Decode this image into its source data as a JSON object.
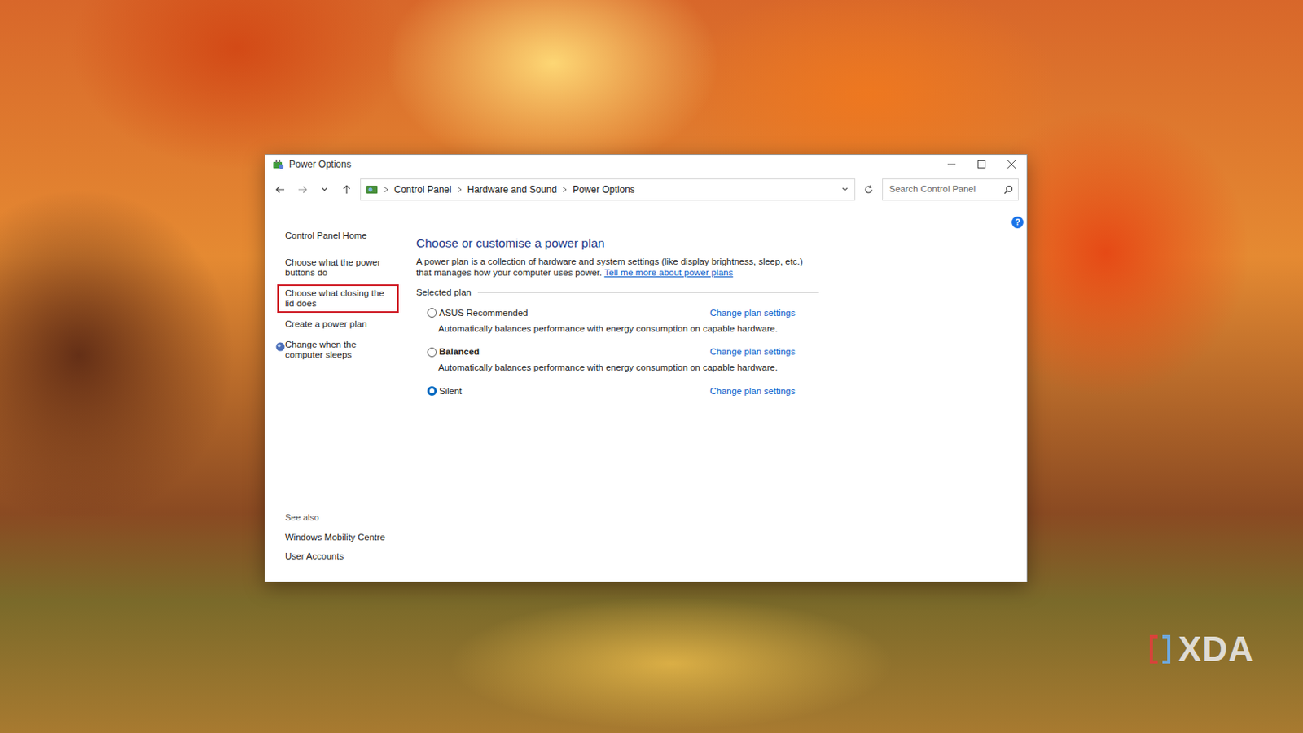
{
  "window": {
    "title": "Power Options"
  },
  "breadcrumb": [
    "Control Panel",
    "Hardware and Sound",
    "Power Options"
  ],
  "search": {
    "placeholder": "Search Control Panel"
  },
  "sidebar": {
    "items": [
      {
        "label": "Control Panel Home",
        "highlighted": false,
        "kind": "plain"
      },
      {
        "label": "Choose what the power buttons do",
        "highlighted": false,
        "kind": "plain"
      },
      {
        "label": "Choose what closing the lid does",
        "highlighted": true,
        "kind": "plain"
      },
      {
        "label": "Create a power plan",
        "highlighted": false,
        "kind": "plain"
      },
      {
        "label": "Change when the computer sleeps",
        "highlighted": false,
        "kind": "icon"
      }
    ],
    "see_also": {
      "title": "See also",
      "items": [
        "Windows Mobility Centre",
        "User Accounts"
      ]
    }
  },
  "main": {
    "heading": "Choose or customise a power plan",
    "description": "A power plan is a collection of hardware and system settings (like display brightness, sleep, etc.) that manages how your computer uses power.",
    "link": "Tell me more about power plans",
    "section": "Selected plan",
    "plans": [
      {
        "name": "ASUS Recommended",
        "selected": false,
        "description": "Automatically balances performance with energy consumption on capable hardware.",
        "action": "Change plan settings"
      },
      {
        "name": "Balanced",
        "selected": false,
        "description": "Automatically balances performance with energy consumption on capable hardware.",
        "action": "Change plan settings"
      },
      {
        "name": "Silent",
        "selected": true,
        "description": "",
        "action": "Change plan settings"
      }
    ]
  },
  "help_icon": "?",
  "watermark": "XDA"
}
